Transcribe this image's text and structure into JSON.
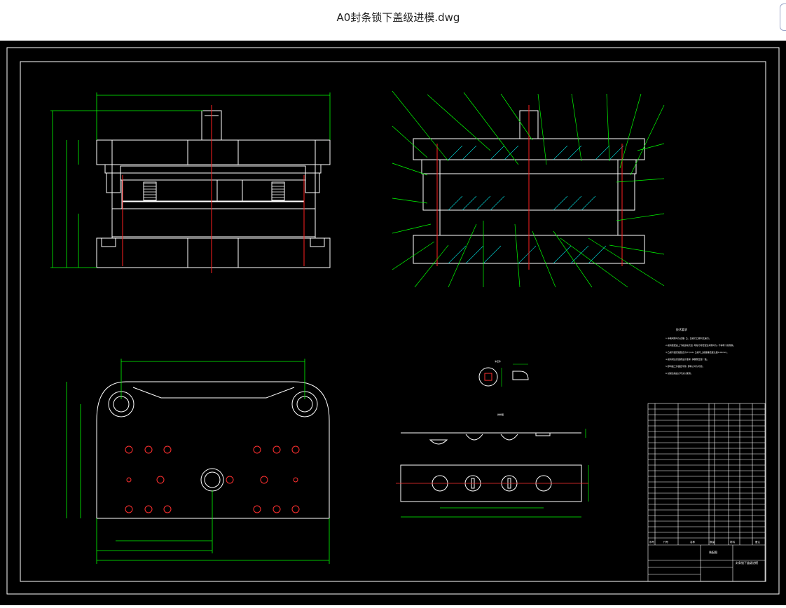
{
  "window": {
    "title": "A0封条锁下盖级进模.dwg"
  },
  "colors": {
    "background": "#000000",
    "line": "#ffffff",
    "dimension": "#00ff00",
    "center": "#ff2020",
    "hatch": "#00e0e0",
    "leader": "#00ff00"
  },
  "icons": {
    "corner_button": "panel-toggle-icon"
  },
  "drawing": {
    "tech_notes_heading": "技术要求",
    "tech_notes": [
      "1.冲裁间隙均匀合理,  凸、凹模刃口锋利无崩刃。",
      "2.模具装配后上下模运动灵活,  导柱与导套配合间隙均匀, 不得有卡滞现象。",
      "3.凸模与固定板配合为H7/m6, 凸模与上模座垂直度允差0.02mm。",
      "4.模具闭合高度按设计要求, 弹簧预压量一致。",
      "5.卸料板工作面应平整, 卸料力均匀可靠。",
      "6.试模合格后方可交付使用。"
    ],
    "part_label": "冲压件",
    "strip_label": "排样图",
    "title_block": {
      "name": "封条锁下盖级进模",
      "material": "装配图",
      "header_cols": [
        "序号",
        "代号",
        "名称",
        "数量",
        "材料",
        "备注"
      ]
    }
  }
}
